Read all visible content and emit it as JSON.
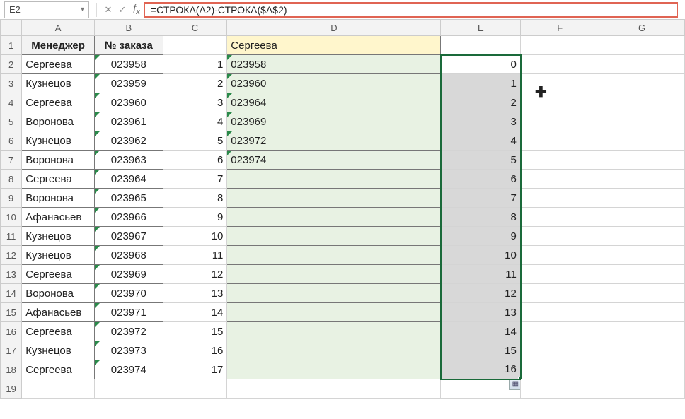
{
  "namebox": {
    "value": "E2"
  },
  "formula": "=СТРОКА(A2)-СТРОКА($A$2)",
  "col_headers": [
    "A",
    "B",
    "C",
    "D",
    "E",
    "F",
    "G"
  ],
  "header_row": {
    "a": "Менеджер",
    "b": "№ заказа"
  },
  "d1": "Сергеева",
  "rows": [
    {
      "n": "2",
      "a": "Сергеева",
      "b": "023958",
      "c": "1",
      "d": "023958",
      "e": "0"
    },
    {
      "n": "3",
      "a": "Кузнецов",
      "b": "023959",
      "c": "2",
      "d": "023960",
      "e": "1"
    },
    {
      "n": "4",
      "a": "Сергеева",
      "b": "023960",
      "c": "3",
      "d": "023964",
      "e": "2"
    },
    {
      "n": "5",
      "a": "Воронова",
      "b": "023961",
      "c": "4",
      "d": "023969",
      "e": "3"
    },
    {
      "n": "6",
      "a": "Кузнецов",
      "b": "023962",
      "c": "5",
      "d": "023972",
      "e": "4"
    },
    {
      "n": "7",
      "a": "Воронова",
      "b": "023963",
      "c": "6",
      "d": "023974",
      "e": "5"
    },
    {
      "n": "8",
      "a": "Сергеева",
      "b": "023964",
      "c": "7",
      "d": "",
      "e": "6"
    },
    {
      "n": "9",
      "a": "Воронова",
      "b": "023965",
      "c": "8",
      "d": "",
      "e": "7"
    },
    {
      "n": "10",
      "a": "Афанасьев",
      "b": "023966",
      "c": "9",
      "d": "",
      "e": "8"
    },
    {
      "n": "11",
      "a": "Кузнецов",
      "b": "023967",
      "c": "10",
      "d": "",
      "e": "9"
    },
    {
      "n": "12",
      "a": "Кузнецов",
      "b": "023968",
      "c": "11",
      "d": "",
      "e": "10"
    },
    {
      "n": "13",
      "a": "Сергеева",
      "b": "023969",
      "c": "12",
      "d": "",
      "e": "11"
    },
    {
      "n": "14",
      "a": "Воронова",
      "b": "023970",
      "c": "13",
      "d": "",
      "e": "12"
    },
    {
      "n": "15",
      "a": "Афанасьев",
      "b": "023971",
      "c": "14",
      "d": "",
      "e": "13"
    },
    {
      "n": "16",
      "a": "Сергеева",
      "b": "023972",
      "c": "15",
      "d": "",
      "e": "14"
    },
    {
      "n": "17",
      "a": "Кузнецов",
      "b": "023973",
      "c": "16",
      "d": "",
      "e": "15"
    },
    {
      "n": "18",
      "a": "Сергеева",
      "b": "023974",
      "c": "17",
      "d": "",
      "e": "16"
    }
  ],
  "last_row": "19"
}
